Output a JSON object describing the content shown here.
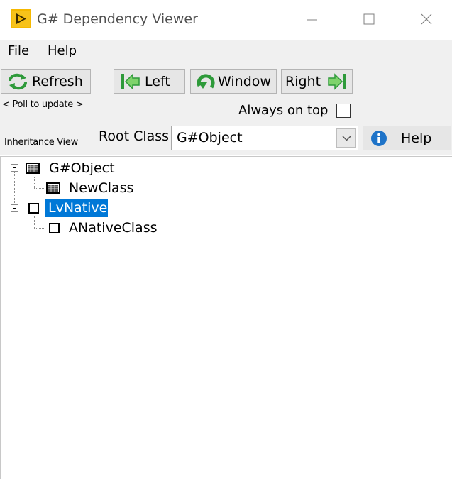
{
  "window": {
    "title": "G# Dependency Viewer"
  },
  "menu": {
    "items": [
      "File",
      "Help"
    ]
  },
  "toolbar": {
    "refresh_label": "Refresh",
    "poll_text": "< Poll to update >",
    "left_label": "Left",
    "window_label": "Window",
    "right_label": "Right",
    "always_on_top_label": "Always on top",
    "always_on_top_checked": false,
    "inheritance_view_label": "Inheritance View",
    "root_class_label": "Root Class",
    "root_class_value": "G#Object",
    "help_label": "Help"
  },
  "tree": {
    "nodes": [
      {
        "label": "G#Object",
        "icon": "gsharp-class-icon",
        "expanded": true
      },
      {
        "label": "NewClass",
        "icon": "gsharp-class-icon"
      },
      {
        "label": "LvNative",
        "icon": "native-class-icon",
        "expanded": true,
        "selected": true
      },
      {
        "label": "ANativeClass",
        "icon": "native-class-icon"
      }
    ]
  },
  "colors": {
    "selection": "#0078d7",
    "arrow_green": "#2e9a3a",
    "info_blue": "#1e73c8",
    "app_icon_yellow": "#f5b800"
  }
}
